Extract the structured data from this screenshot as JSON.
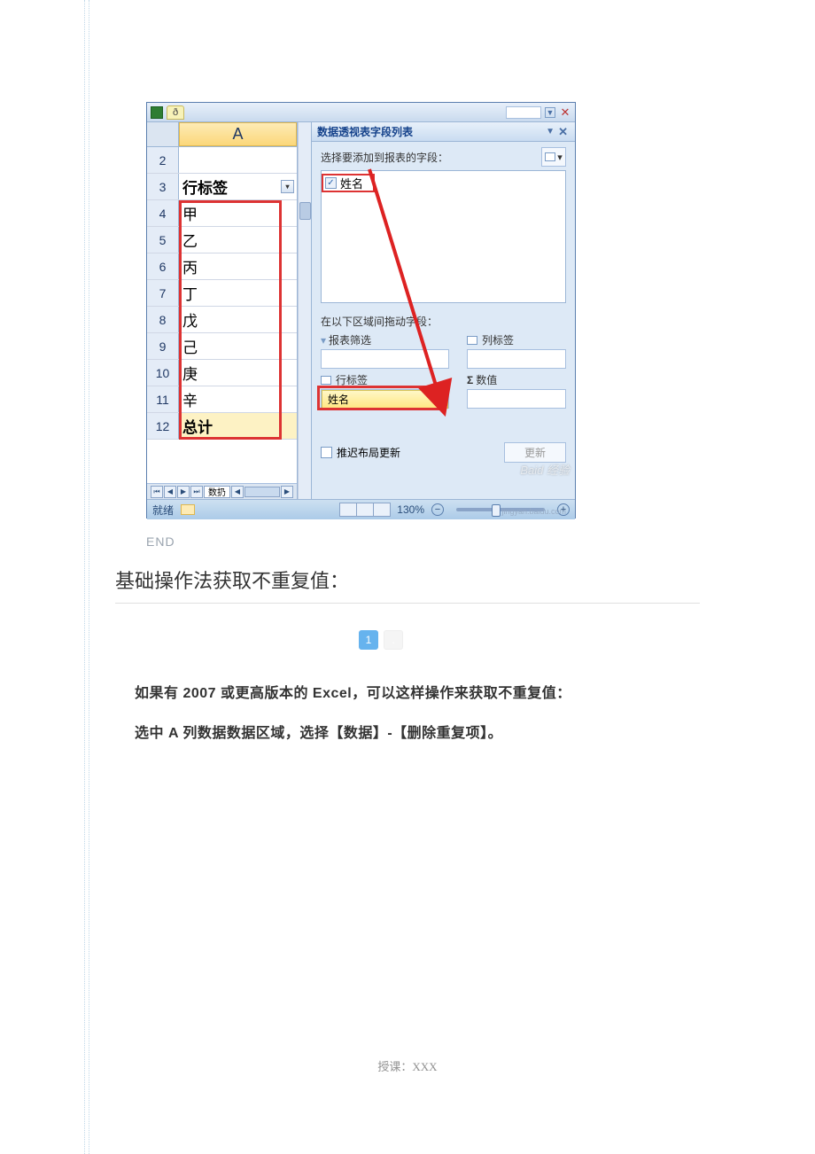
{
  "excel": {
    "tab_label": "ð",
    "col_header": "A",
    "rows": [
      {
        "n": "2",
        "v": ""
      },
      {
        "n": "3",
        "v": "行标签"
      },
      {
        "n": "4",
        "v": "甲"
      },
      {
        "n": "5",
        "v": "乙"
      },
      {
        "n": "6",
        "v": "丙"
      },
      {
        "n": "7",
        "v": "丁"
      },
      {
        "n": "8",
        "v": "戊"
      },
      {
        "n": "9",
        "v": "己"
      },
      {
        "n": "10",
        "v": "庚"
      },
      {
        "n": "11",
        "v": "辛"
      },
      {
        "n": "12",
        "v": "总计"
      }
    ],
    "pane_title": "数据透视表字段列表",
    "choose_label": "选择要添加到报表的字段：",
    "field_name": "姓名",
    "areas_label": "在以下区域间拖动字段：",
    "area_filter": "报表筛选",
    "area_col": "列标签",
    "area_row": "行标签",
    "area_val": "数值",
    "row_item": "姓名",
    "defer_label": "推迟布局更新",
    "update_btn": "更新",
    "status_ready": "就绪",
    "zoom": "130%",
    "sheet_tab": "数扔",
    "watermark": "Baid 经验",
    "watermark2": "jingyan.baidu.com"
  },
  "end_label": "END",
  "section_title": "基础操作法获取不重复值：",
  "step": "1",
  "para1": "如果有 2007 或更高版本的 Excel，可以这样操作来获取不重复值：",
  "para2": "选中 A 列数据数据区域，选择【数据】-【删除重复项】。",
  "footer": "授课：XXX"
}
